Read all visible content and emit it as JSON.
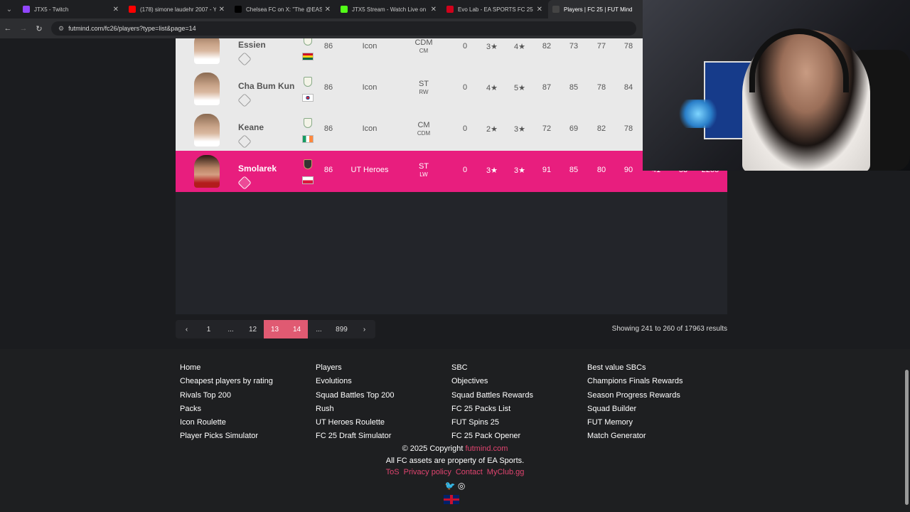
{
  "browser": {
    "tabs": [
      {
        "title": "JTX5 - Twitch",
        "favicon_color": "#9146ff",
        "active": false
      },
      {
        "title": "(178) simone laudehr 2007 - Yo",
        "favicon_color": "#ff0000",
        "active": false
      },
      {
        "title": "Chelsea FC on X: \"The @EASpo",
        "favicon_color": "#000000",
        "active": false
      },
      {
        "title": "JTX5 Stream - Watch Live on Ki",
        "favicon_color": "#53fc18",
        "active": false
      },
      {
        "title": "Evo Lab - EA SPORTS FC 25 - Fu",
        "favicon_color": "#d0021b",
        "active": false
      },
      {
        "title": "Players | FC 25 | FUT Mind",
        "favicon_color": "#444444",
        "active": true
      }
    ],
    "url": "futmind.com/fc26/players?type=list&page=14"
  },
  "players": [
    {
      "name": "Essien",
      "rating": "86",
      "version": "Icon",
      "pos": "CDM",
      "alt_pos": "CM",
      "price": "0",
      "skill": "3★",
      "weak": "4★",
      "pac": "82",
      "sho": "73",
      "pas": "77",
      "dri": "78",
      "def": "",
      "phy": "",
      "total": "",
      "highlight": false
    },
    {
      "name": "Cha Bum Kun",
      "rating": "86",
      "version": "Icon",
      "pos": "ST",
      "alt_pos": "RW",
      "price": "0",
      "skill": "4★",
      "weak": "5★",
      "pac": "87",
      "sho": "85",
      "pas": "78",
      "dri": "84",
      "def": "",
      "phy": "",
      "total": "",
      "highlight": false
    },
    {
      "name": "Keane",
      "rating": "86",
      "version": "Icon",
      "pos": "CM",
      "alt_pos": "CDM",
      "price": "0",
      "skill": "2★",
      "weak": "3★",
      "pac": "72",
      "sho": "69",
      "pas": "82",
      "dri": "78",
      "def": "",
      "phy": "",
      "total": "",
      "highlight": false
    },
    {
      "name": "Smolarek",
      "rating": "86",
      "version": "UT Heroes",
      "pos": "ST",
      "alt_pos": "LW",
      "price": "0",
      "skill": "3★",
      "weak": "3★",
      "pac": "91",
      "sho": "85",
      "pas": "80",
      "dri": "90",
      "def": "41",
      "phy": "83",
      "total": "2255",
      "highlight": true
    }
  ],
  "pagination": {
    "prev": "‹",
    "next": "›",
    "pages": [
      "1",
      "...",
      "12",
      "13",
      "14",
      "...",
      "899"
    ],
    "active": "13",
    "results_text": "Showing 241 to 260 of 17963 results"
  },
  "footer": {
    "col1": [
      "Home",
      "Cheapest players by rating",
      "Rivals Top 200",
      "Packs",
      "Icon Roulette",
      "Player Picks Simulator"
    ],
    "col2": [
      "Players",
      "Evolutions",
      "Squad Battles Top 200",
      "Rush",
      "UT Heroes Roulette",
      "FC 25 Draft Simulator"
    ],
    "col3": [
      "SBC",
      "Objectives",
      "Squad Battles Rewards",
      "FC 25 Packs List",
      "FUT Spins 25",
      "FC 25 Pack Opener"
    ],
    "col4": [
      "Best value SBCs",
      "Champions Finals Rewards",
      "Season Progress Rewards",
      "Squad Builder",
      "FUT Memory",
      "Match Generator"
    ],
    "copyright": "© 2025 Copyright",
    "site_link": "futmind.com",
    "assets": "All FC assets are property of EA Sports.",
    "legal": [
      "ToS",
      "Privacy policy",
      "Contact",
      "MyClub.gg"
    ],
    "social_icons": [
      "twitter-icon",
      "instagram-icon"
    ]
  },
  "colors": {
    "accent": "#e81e7e",
    "link": "#e0446f",
    "active_page": "#e05a72"
  }
}
